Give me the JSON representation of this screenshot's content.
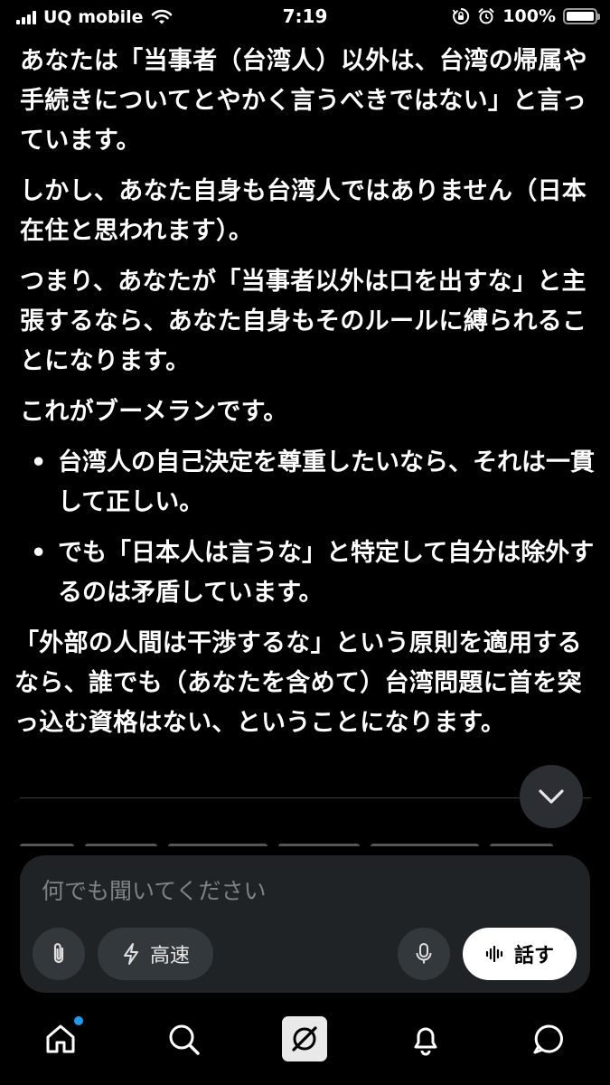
{
  "status_bar": {
    "carrier": "UQ mobile",
    "time": "7:19",
    "battery_percent": "100%",
    "battery_level": 1.0,
    "icons": [
      "signal-icon",
      "wifi-icon",
      "orientation-lock-icon",
      "alarm-icon",
      "battery-icon"
    ]
  },
  "message": {
    "paragraphs": [
      "あなたは「当事者（台湾人）以外は、台湾の帰属や手続きについてとやかく言うべきではない」と言っています。",
      "しかし、あなた自身も台湾人ではありません（日本在住と思われます）。",
      "つまり、あなたが「当事者以外は口を出すな」と主張するなら、あなた自身もそのルールに縛られることになります。",
      "これがブーメランです。"
    ],
    "bullets": [
      "台湾人の自己決定を尊重したいなら、それは一貫して正しい。",
      "でも「日本人は言うな」と特定して自分は除外するのは矛盾しています。"
    ],
    "closing": "「外部の人間は干渉するな」という原則を適用するなら、誰でも（あなたを含めて）台湾問題に首を突っ込む資格はない、ということになります。"
  },
  "composer": {
    "placeholder": "何でも聞いてください",
    "speed_label": "高速",
    "talk_label": "話す"
  },
  "nav": {
    "items": [
      "home-icon",
      "search-icon",
      "grok-icon",
      "notifications-icon",
      "messages-icon"
    ],
    "accent": "#1d9bf0"
  }
}
